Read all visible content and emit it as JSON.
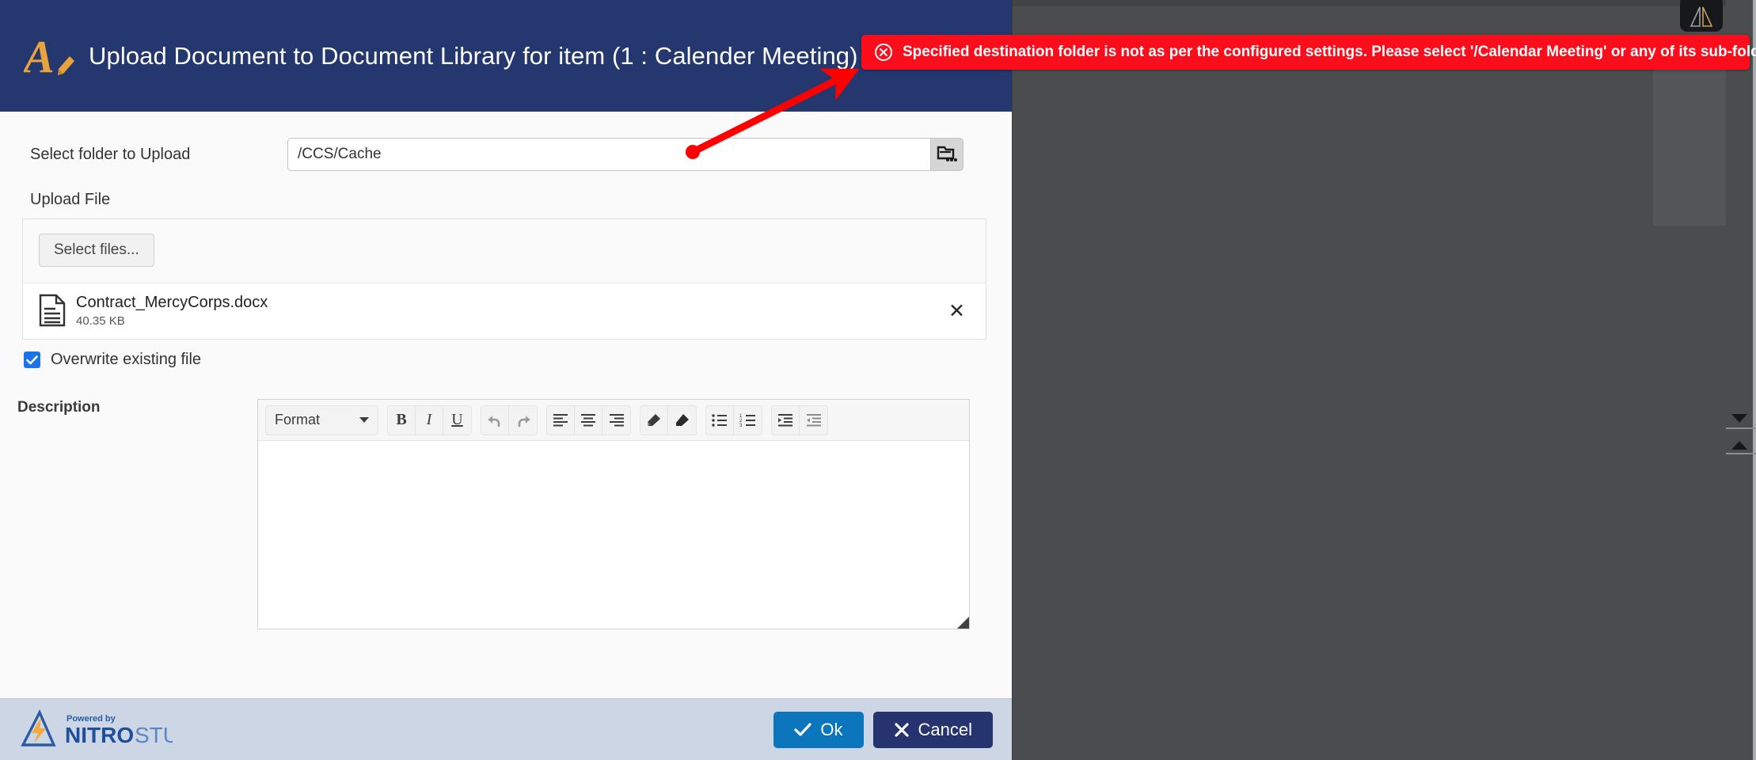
{
  "modal": {
    "title": "Upload Document to Document Library for item (1 : Calender Meeting)",
    "app_icon": "document-edit-icon",
    "folder": {
      "label": "Select folder to Upload",
      "value": "/CCS/Cache",
      "placeholder": "",
      "browse_icon": "folder-browse-icon"
    },
    "upload": {
      "section_label": "Upload File",
      "select_files_label": "Select files...",
      "files": [
        {
          "name": "Contract_MercyCorps.docx",
          "size": "40.35 KB",
          "icon": "document-file-icon",
          "remove_label": "✕"
        }
      ],
      "overwrite": {
        "label": "Overwrite existing file",
        "checked": true
      }
    },
    "description": {
      "label": "Description",
      "content": "",
      "toolbar": {
        "format_label": "Format",
        "buttons": [
          {
            "name": "bold-button",
            "glyph": "B"
          },
          {
            "name": "italic-button",
            "glyph": "I"
          },
          {
            "name": "underline-button",
            "glyph": "U"
          },
          {
            "name": "undo-button",
            "glyph": "undo-icon"
          },
          {
            "name": "redo-button",
            "glyph": "redo-icon"
          },
          {
            "name": "align-left-button",
            "glyph": "align-left-icon"
          },
          {
            "name": "align-center-button",
            "glyph": "align-center-icon"
          },
          {
            "name": "align-right-button",
            "glyph": "align-right-icon"
          },
          {
            "name": "text-color-button",
            "glyph": "text-color-icon"
          },
          {
            "name": "highlight-color-button",
            "glyph": "highlight-icon"
          },
          {
            "name": "bullet-list-button",
            "glyph": "bullet-list-icon"
          },
          {
            "name": "numbered-list-button",
            "glyph": "numbered-list-icon"
          },
          {
            "name": "indent-increase-button",
            "glyph": "indent-increase-icon"
          },
          {
            "name": "indent-decrease-button",
            "glyph": "indent-decrease-icon"
          }
        ]
      }
    },
    "footer": {
      "brand_powered_by": "Powered by",
      "brand_name_bold": "NITRO",
      "brand_name_light": "STUDIO",
      "ok_label": "Ok",
      "cancel_label": "Cancel"
    }
  },
  "toast": {
    "message": "Specified destination folder is not as per the configured settings. Please select '/Calendar Meeting' or any of its sub-folders.",
    "icon": "error-circle-x-icon",
    "background": "#FC0D1B",
    "text_color": "#FFFFFF"
  },
  "background": {
    "mirror_icon": "mirror-flip-icon",
    "scroll_down_icon": "chevron-down-icon",
    "scroll_up_icon": "chevron-up-icon"
  },
  "theme": {
    "header_navy": "#24376F",
    "ok_blue": "#0C76BC",
    "cancel_navy": "#25346E",
    "footer_blue_grey": "#CCD6E4",
    "checkbox_blue": "#1A73E8",
    "annotation_red": "#FF0000",
    "brand_orange": "#E8A33D"
  }
}
